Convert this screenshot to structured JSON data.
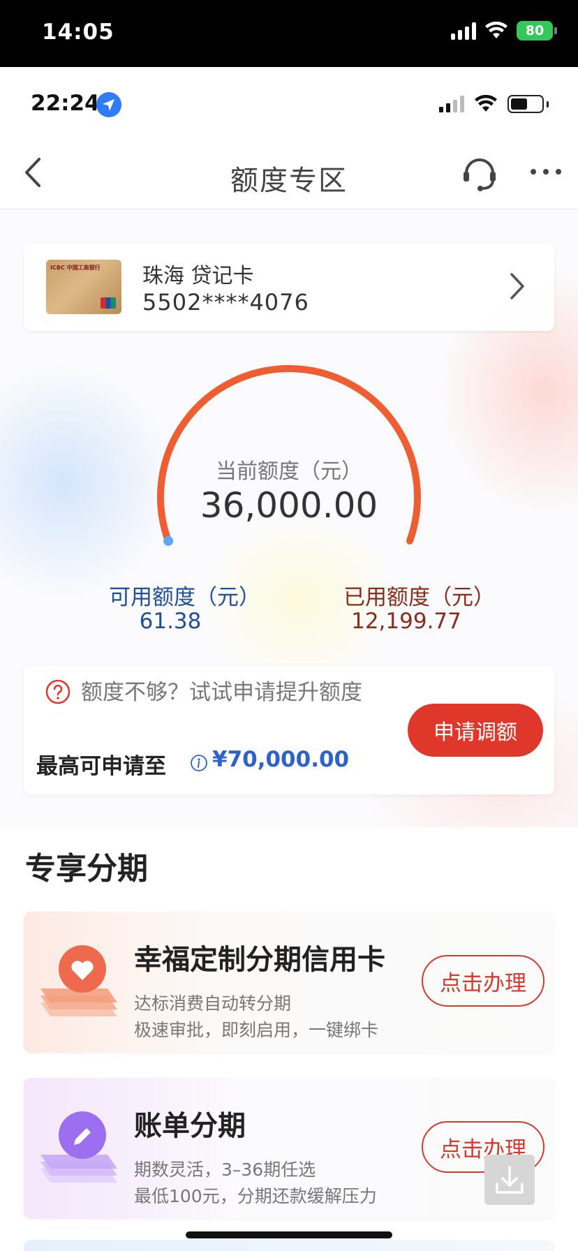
{
  "outer_status": {
    "time": "14:05",
    "battery": "80"
  },
  "inner_status": {
    "time": "22:24"
  },
  "nav": {
    "title": "额度专区"
  },
  "card": {
    "name": "珠海 贷记卡",
    "number": "5502****4076",
    "logo_text": "ICBC 中国工商银行"
  },
  "credit": {
    "current_label": "当前额度（元）",
    "current_value": "36,000.00",
    "available_label": "可用额度（元）",
    "available_value": "61.38",
    "used_label": "已用额度（元）",
    "used_value": "12,199.77",
    "used_fraction": 0.998
  },
  "promo": {
    "question": "额度不够？试试申请提升额度",
    "max_label": "最高可申请至",
    "max_amount": "¥70,000.00",
    "button": "申请调额"
  },
  "section": {
    "title": "专享分期"
  },
  "installments": [
    {
      "title": "幸福定制分期信用卡",
      "line1": "达标消费自动转分期",
      "line2": "极速审批，即刻启用，一键绑卡",
      "button": "点击办理",
      "icon": "heart-icon",
      "accent": "#f07a5a"
    },
    {
      "title": "账单分期",
      "line1": "期数灵活，3–36期任选",
      "line2": "最低100元，分期还款缓解压力",
      "button": "点击办理",
      "icon": "pencil-icon",
      "accent": "#9b6ff0"
    }
  ],
  "colors": {
    "gauge_arc": "#ef5e33",
    "primary_red": "#e0372b",
    "available_blue": "#1f4e9a",
    "used_brown": "#8a2c1b"
  }
}
